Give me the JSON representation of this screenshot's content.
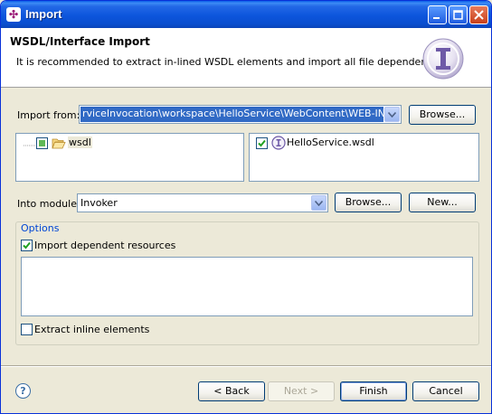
{
  "window": {
    "title": "Import"
  },
  "header": {
    "title": "WSDL/Interface Import",
    "description": "It is recommended to extract in-lined WSDL elements and import all file dependencies"
  },
  "import_from": {
    "label": "Import from:",
    "value": "rviceInvocation\\workspace\\HelloService\\WebContent\\WEB-INF\\wsdl",
    "browse_label": "Browse..."
  },
  "left_tree": {
    "items": [
      {
        "label": "wsdl",
        "checked": "partial"
      }
    ]
  },
  "right_list": {
    "items": [
      {
        "label": "HelloService.wsdl",
        "checked": true
      }
    ]
  },
  "into_module": {
    "label": "Into module:",
    "value": "Invoker",
    "browse_label": "Browse...",
    "new_label": "New..."
  },
  "options": {
    "legend": "Options",
    "import_dependent": {
      "label": "Import dependent resources",
      "checked": true
    },
    "extract_inline": {
      "label": "Extract inline elements",
      "checked": false
    }
  },
  "footer": {
    "help_glyph": "?",
    "back_label": "< Back",
    "next_label": "Next >",
    "finish_label": "Finish",
    "cancel_label": "Cancel"
  }
}
